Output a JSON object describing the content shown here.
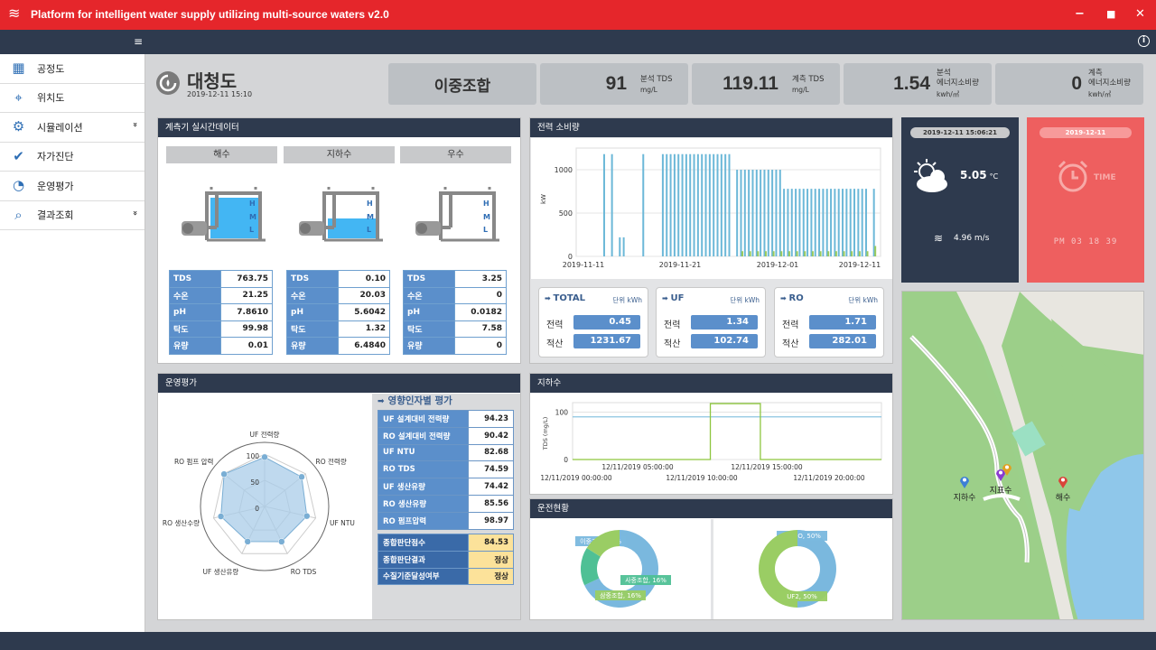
{
  "app": {
    "title": "Platform for intelligent water supply utilizing multi-source waters v2.0"
  },
  "sidebar": {
    "items": [
      {
        "label": "공정도",
        "icon": "process-diagram-icon",
        "chevron": false
      },
      {
        "label": "위치도",
        "icon": "map-location-icon",
        "chevron": false
      },
      {
        "label": "시뮬레이션",
        "icon": "simulation-icon",
        "chevron": true
      },
      {
        "label": "자가진단",
        "icon": "self-diagnosis-icon",
        "chevron": false
      },
      {
        "label": "운영평가",
        "icon": "pie-chart-icon",
        "chevron": false
      },
      {
        "label": "결과조회",
        "icon": "results-icon",
        "chevron": true
      }
    ]
  },
  "site": {
    "name": "대청도",
    "datetime": "2019-12-11 15:10"
  },
  "kpis": {
    "mode": "이중조합",
    "analysis_tds": {
      "value": "91",
      "label": "분석 TDS",
      "unit": "mg/L"
    },
    "measured_tds": {
      "value": "119.11",
      "label": "계측 TDS",
      "unit": "mg/L"
    },
    "analysis_energy": {
      "value": "1.54",
      "label1": "분석",
      "label2": "에너지소비량",
      "unit": "kwh/㎥"
    },
    "measured_energy": {
      "value": "0",
      "label1": "계측",
      "label2": "에너지소비량",
      "unit": "kwh/㎥"
    }
  },
  "sensors": {
    "title": "계측기 실시간데이터",
    "level_labels": {
      "h": "H",
      "m": "M",
      "l": "L"
    },
    "tanks": [
      {
        "name": "해수",
        "level": 0.78,
        "rows": [
          {
            "k": "TDS",
            "v": "763.75"
          },
          {
            "k": "수온",
            "v": "21.25"
          },
          {
            "k": "pH",
            "v": "7.8610"
          },
          {
            "k": "탁도",
            "v": "99.98"
          },
          {
            "k": "유량",
            "v": "0.01"
          }
        ]
      },
      {
        "name": "지하수",
        "level": 0.38,
        "rows": [
          {
            "k": "TDS",
            "v": "0.10"
          },
          {
            "k": "수온",
            "v": "20.03"
          },
          {
            "k": "pH",
            "v": "5.6042"
          },
          {
            "k": "탁도",
            "v": "1.32"
          },
          {
            "k": "유량",
            "v": "6.4840"
          }
        ]
      },
      {
        "name": "우수",
        "level": 0.0,
        "rows": [
          {
            "k": "TDS",
            "v": "3.25"
          },
          {
            "k": "수온",
            "v": "0"
          },
          {
            "k": "pH",
            "v": "0.0182"
          },
          {
            "k": "탁도",
            "v": "7.58"
          },
          {
            "k": "유량",
            "v": "0"
          }
        ]
      }
    ]
  },
  "power": {
    "title": "전력 소비량",
    "chart_data": {
      "type": "bar",
      "ylabel": "kW",
      "ylim": [
        0,
        1250
      ],
      "yticks": [
        "0",
        "500",
        "1000"
      ],
      "xticks": [
        "2019-11-11",
        "2019-11-21",
        "2019-12-01",
        "2019-12-11"
      ],
      "series": [
        {
          "color": "#6cb8d8",
          "values": [
            0,
            0,
            0,
            0,
            0,
            0,
            1180,
            0,
            1180,
            0,
            220,
            220,
            0,
            0,
            0,
            0,
            1180,
            0,
            0,
            0,
            0,
            1180,
            1180,
            1180,
            1180,
            1180,
            1180,
            1180,
            1180,
            1180,
            1180,
            1180,
            1180,
            1180,
            1180,
            1180,
            1180,
            1180,
            1180,
            0,
            1000,
            1000,
            1000,
            1000,
            1000,
            1000,
            1000,
            1000,
            1000,
            1000,
            1000,
            1000,
            780,
            780,
            780,
            780,
            780,
            780,
            780,
            780,
            780,
            780,
            780,
            780,
            780,
            780,
            780,
            780,
            780,
            780,
            780,
            780,
            780,
            780,
            0,
            780,
            0
          ]
        },
        {
          "color": "#9acb5c",
          "values": [
            0,
            0,
            0,
            0,
            0,
            0,
            0,
            0,
            0,
            0,
            0,
            0,
            0,
            0,
            0,
            0,
            0,
            0,
            0,
            0,
            0,
            0,
            0,
            0,
            0,
            0,
            0,
            0,
            0,
            0,
            0,
            0,
            0,
            0,
            0,
            0,
            0,
            0,
            0,
            0,
            0,
            60,
            0,
            60,
            0,
            60,
            0,
            60,
            0,
            60,
            0,
            60,
            0,
            60,
            0,
            60,
            0,
            60,
            0,
            60,
            0,
            60,
            0,
            60,
            0,
            60,
            0,
            60,
            0,
            60,
            0,
            60,
            0,
            60,
            0,
            120,
            0
          ]
        }
      ]
    },
    "boxes": [
      {
        "title": "TOTAL",
        "unit": "단위 kWh",
        "power_label": "전력",
        "power": "0.45",
        "acc_label": "적산",
        "acc": "1231.67"
      },
      {
        "title": "UF",
        "unit": "단위 kWh",
        "power_label": "전력",
        "power": "1.34",
        "acc_label": "적산",
        "acc": "102.74"
      },
      {
        "title": "RO",
        "unit": "단위 kWh",
        "power_label": "전력",
        "power": "1.71",
        "acc_label": "적산",
        "acc": "282.01"
      }
    ]
  },
  "weather": {
    "datetime": "2019-12-11 15:06:21",
    "temp": "5.05",
    "temp_unit": "°C",
    "wind": "4.96 m/s"
  },
  "clock": {
    "date": "2019-12-11",
    "label": "TIME",
    "time": "PM 03 18 39"
  },
  "evaluation": {
    "title": "운영평가",
    "section_title": "영향인자별 평가",
    "chart_data": {
      "type": "radar",
      "axes": [
        "UF 전력량",
        "RO 전력량",
        "UF NTU",
        "RO TDS",
        "UF 생산유량",
        "RO 생산수량",
        "RO 펌프 압력"
      ],
      "values": [
        94.23,
        90.42,
        82.68,
        74.59,
        74.42,
        85.56,
        98.97
      ],
      "rmax": 100,
      "ticks": [
        "100",
        "50",
        "0"
      ]
    },
    "rows": [
      {
        "k": "UF 설계대비 전력량",
        "v": "94.23"
      },
      {
        "k": "RO 설계대비 전력량",
        "v": "90.42"
      },
      {
        "k": "UF NTU",
        "v": "82.68"
      },
      {
        "k": "RO TDS",
        "v": "74.59"
      },
      {
        "k": "UF 생산유량",
        "v": "74.42"
      },
      {
        "k": "RO 생산유량",
        "v": "85.56"
      },
      {
        "k": "RO 펌프압력",
        "v": "98.97"
      }
    ],
    "summary": [
      {
        "k": "종합판단점수",
        "v": "84.53"
      },
      {
        "k": "종합판단결과",
        "v": "정상"
      },
      {
        "k": "수질기준달성여부",
        "v": "정상"
      }
    ]
  },
  "groundwater": {
    "title": "지하수",
    "chart_data": {
      "type": "line",
      "ylabel": "TDS (mg/L)",
      "ylim": [
        0,
        120
      ],
      "yticks": [
        "0",
        "100"
      ],
      "xticks_top": [
        "12/11/2019 05:00:00",
        "12/11/2019 15:00:00"
      ],
      "xticks_bottom": [
        "12/11/2019 00:00:00",
        "12/11/2019 10:00:00",
        "12/11/2019 20:00:00"
      ],
      "series": [
        {
          "name": "baseline",
          "color": "#8cc5e0",
          "x": [
            0,
            1
          ],
          "y": [
            90,
            90
          ]
        },
        {
          "name": "pulse",
          "color": "#8dc63f",
          "x": [
            0,
            0.446,
            0.446,
            0.608,
            0.608,
            1
          ],
          "y": [
            0,
            0,
            118,
            118,
            0,
            0
          ]
        }
      ]
    }
  },
  "operation": {
    "title": "운전현황",
    "chart_data": [
      {
        "type": "pie",
        "slices": [
          {
            "label": "이중조합, 68%",
            "value": 68,
            "color": "#7ab8de"
          },
          {
            "label": "사중조합, 16%",
            "value": 16,
            "color": "#4fc095"
          },
          {
            "label": "삼중조합, 16%",
            "value": 16,
            "color": "#9acd64"
          }
        ]
      },
      {
        "type": "pie",
        "slices": [
          {
            "label": "BWRO, 50%",
            "value": 50,
            "color": "#7ab8de"
          },
          {
            "label": "UF2, 50%",
            "value": 50,
            "color": "#9acd64"
          }
        ]
      }
    ]
  },
  "map": {
    "markers": [
      {
        "label": "지하수",
        "color": "#3d7fd6"
      },
      {
        "label": "지표수",
        "color": "#8a3bd0"
      },
      {
        "label": "",
        "color": "#e0a020"
      },
      {
        "label": "해수",
        "color": "#d9443a"
      }
    ]
  }
}
